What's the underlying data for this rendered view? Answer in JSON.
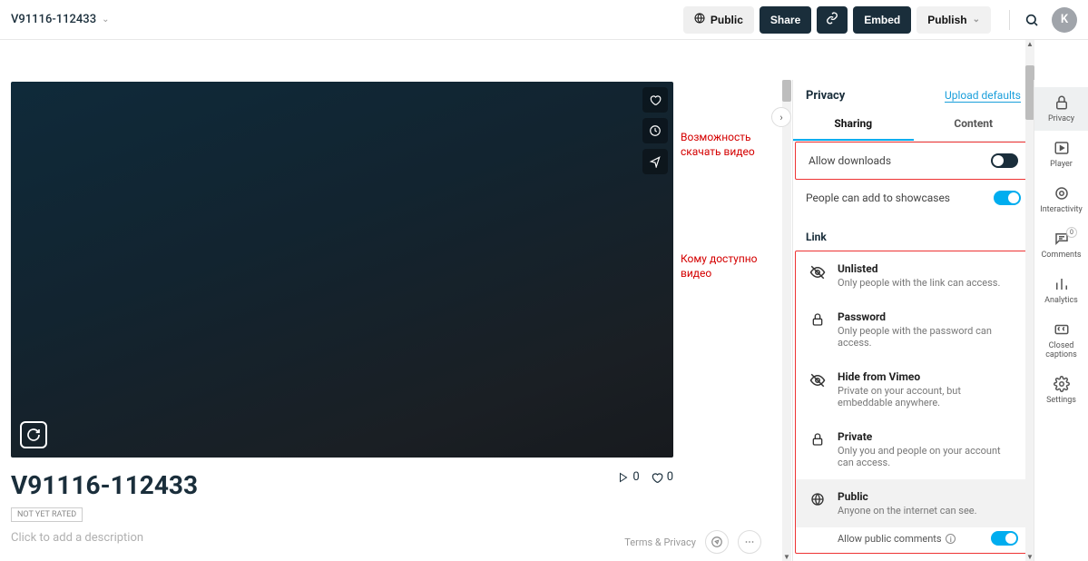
{
  "topbar": {
    "title": "V91116-112433",
    "public_label": "Public",
    "share_label": "Share",
    "embed_label": "Embed",
    "publish_label": "Publish",
    "avatar_letter": "K"
  },
  "video": {
    "title": "V91116-112433",
    "rating_badge": "NOT YET RATED",
    "description_placeholder": "Click to add a description",
    "plays_count": "0",
    "likes_count": "0"
  },
  "footer": {
    "terms_label": "Terms & Privacy"
  },
  "annotations": {
    "downloads": "Возможность\nскачать видео",
    "access": "Кому доступно\nвидео"
  },
  "panel": {
    "title": "Privacy",
    "upload_defaults": "Upload defaults",
    "tabs": {
      "sharing": "Sharing",
      "content": "Content"
    },
    "allow_downloads": "Allow downloads",
    "add_showcases": "People can add to showcases",
    "link_section": "Link",
    "options": {
      "unlisted": {
        "title": "Unlisted",
        "desc": "Only people with the link can access."
      },
      "password": {
        "title": "Password",
        "desc": "Only people with the password can access."
      },
      "hide": {
        "title": "Hide from Vimeo",
        "desc": "Private on your account, but embeddable anywhere."
      },
      "private": {
        "title": "Private",
        "desc": "Only you and people on your account can access."
      },
      "public": {
        "title": "Public",
        "desc": "Anyone on the internet can see."
      }
    },
    "allow_public_comments": "Allow public comments"
  },
  "rail": {
    "privacy": "Privacy",
    "player": "Player",
    "interactivity": "Interactivity",
    "comments": "Comments",
    "comments_badge": "0",
    "analytics": "Analytics",
    "closed_captions": "Closed\ncaptions",
    "settings": "Settings"
  }
}
